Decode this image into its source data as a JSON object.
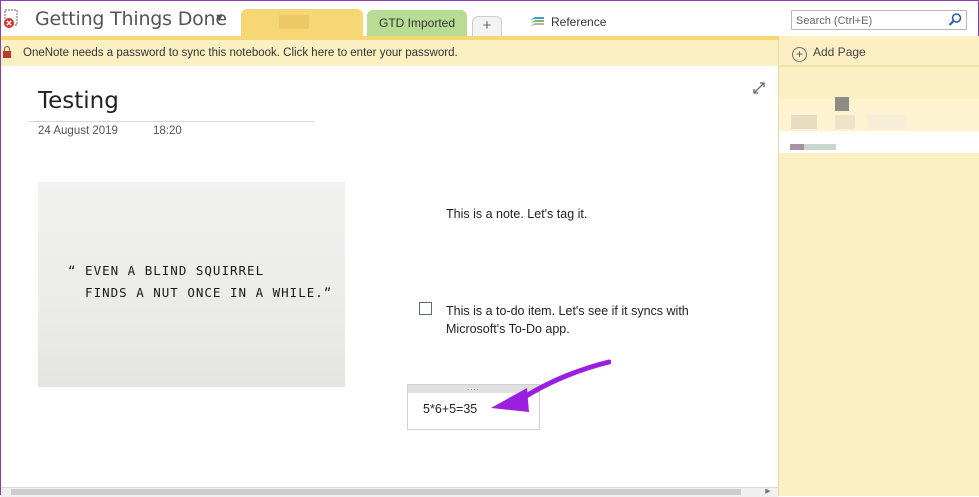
{
  "notebook": {
    "title": "Getting Things Done",
    "caret": "▼"
  },
  "tabs": [
    {
      "label": "",
      "active": true
    },
    {
      "label": "GTD Imported",
      "color": "#b9dc95"
    }
  ],
  "add_tab_label": "+",
  "reference": {
    "label": "Reference"
  },
  "search": {
    "placeholder": "Search (Ctrl+E)"
  },
  "notification": {
    "message": "OneNote needs a password to sync this notebook. Click here to enter your password."
  },
  "page": {
    "title": "Testing",
    "date": "24 August 2019",
    "time": "18:20",
    "image_quote": "“ EVEN A BLIND SQUIRREL\n  FINDS A NUT ONCE IN A WHILE.”",
    "note_text": "This is a note. Let's tag it.",
    "todo_text": "This is a to-do item. Let's see if it syncs with Microsoft's To-Do app.",
    "todo_checked": false,
    "calc_grip": "....",
    "calc_expression": "5*6+5=35"
  },
  "panel": {
    "add_page_label": "Add Page",
    "add_page_icon": "+"
  },
  "colors": {
    "accent": "#f7d774",
    "notification_bg": "#fbf0c2",
    "panel_bg": "#fcefc4",
    "arrow": "#9b1fe0",
    "window_border": "#8a3fb0"
  }
}
